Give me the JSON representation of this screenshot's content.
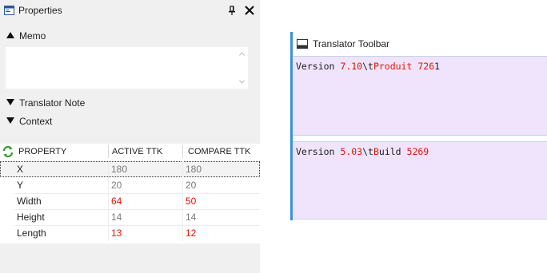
{
  "properties_panel": {
    "title": "Properties",
    "sections": {
      "memo": "Memo",
      "translator_note": "Translator Note",
      "context": "Context"
    },
    "grid": {
      "headers": [
        "PROPERTY",
        "ACTIVE TTK",
        "COMPARE TTK"
      ],
      "rows": [
        {
          "property": "X",
          "active": "180",
          "compare": "180"
        },
        {
          "property": "Y",
          "active": "20",
          "compare": "20"
        },
        {
          "property": "Width",
          "active": "64",
          "compare": "50"
        },
        {
          "property": "Height",
          "active": "14",
          "compare": "14"
        },
        {
          "property": "Length",
          "active": "13",
          "compare": "12"
        }
      ]
    }
  },
  "translator_toolbar": {
    "title": "Translator Toolbar",
    "box1": {
      "p1": "Version ",
      "v1": "7.10",
      "p2": "\\t",
      "v2": "Produit",
      "p3": " ",
      "v3": "726",
      "p4": "1"
    },
    "box2": {
      "p1": "Version ",
      "v1": "5.03",
      "p2": "\\t",
      "v2": "B",
      "p3": "uild ",
      "v3": "5269"
    }
  },
  "colors": {
    "accent": "#3c8fdc",
    "diff": "#e51400",
    "highlight": "#efe4fc"
  }
}
